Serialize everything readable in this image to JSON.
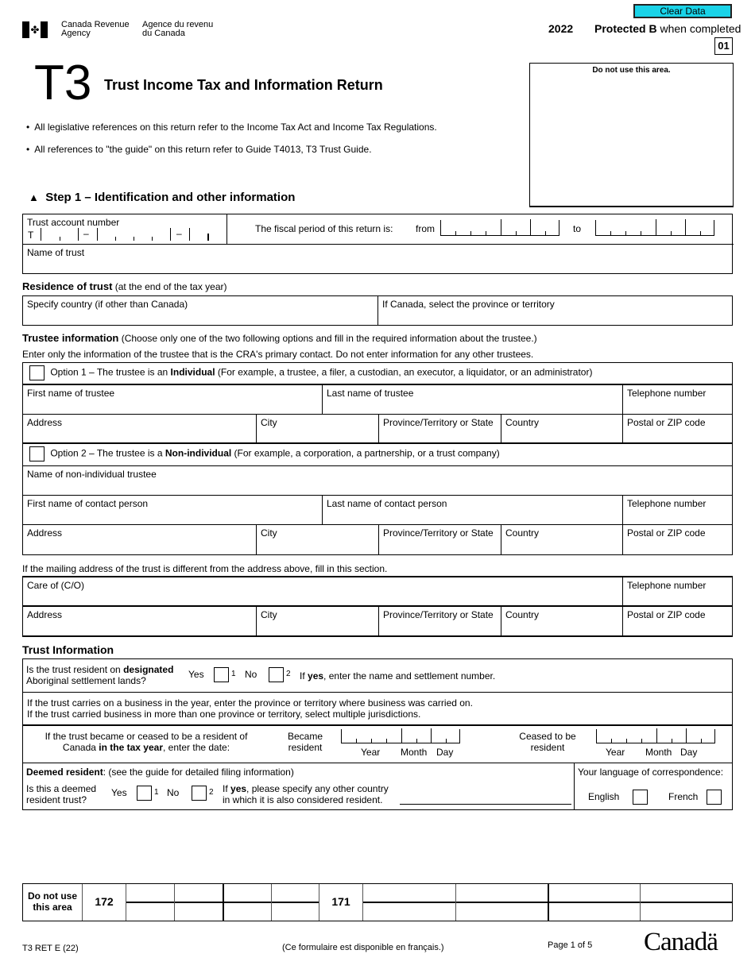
{
  "header": {
    "agency_en": [
      "Canada Revenue",
      "Agency"
    ],
    "agency_fr": [
      "Agence du revenu",
      "du Canada"
    ],
    "clear_button": "Clear Data",
    "year": "2022",
    "protected": "Protected B",
    "protected_suffix": " when completed",
    "page_code": "01",
    "do_not_use": "Do not use this area.",
    "form_code": "T3",
    "title": "Trust Income Tax and Information Return",
    "bullets": [
      "All legislative references on this return refer to the Income Tax Act and Income Tax Regulations.",
      "All references to \"the guide\" on this return refer to Guide T4013, T3 Trust Guide."
    ]
  },
  "step1": {
    "heading": "Step 1 – Identification and other information",
    "account_label": "Trust account number",
    "account_prefix": "T",
    "dash": "–",
    "fiscal_label": "The fiscal period of this return is:",
    "from": "from",
    "to": "to",
    "name_label": "Name of trust"
  },
  "residence": {
    "heading": "Residence of trust",
    "sub": " (at the end of the tax year)",
    "country_label": "Specify country (if other than Canada)",
    "province_label": "If Canada, select the province or territory"
  },
  "trustee": {
    "heading": "Trustee information",
    "sub": " (Choose only one of the two following options and fill in the required information about the trustee.)",
    "note": "Enter only the information of the trustee that is the CRA's primary contact. Do not enter information for any other trustees.",
    "option1_pre": "Option 1 – The trustee is an ",
    "option1_bold": "Individual",
    "option1_post": " (For example, a trustee, a filer, a custodian, an executor, a liquidator, or an administrator)",
    "first_name": "First name of trustee",
    "last_name": "Last name of trustee",
    "telephone": "Telephone number",
    "address": "Address",
    "city": "City",
    "province": "Province/Territory or State",
    "country": "Country",
    "postal": "Postal or ZIP code",
    "option2_pre": "Option 2 – The trustee is a ",
    "option2_bold": "Non-individual",
    "option2_post": " (For example, a corporation, a partnership, or a trust company)",
    "non_ind_name": "Name of non-individual trustee",
    "contact_first": "First name of contact person",
    "contact_last": "Last name of contact person"
  },
  "mailing": {
    "note": "If the mailing address of the trust is different from the address above, fill in this section.",
    "care_of": "Care of (C/O)"
  },
  "trust_info": {
    "heading": "Trust Information",
    "aboriginal_pre": "Is the trust resident on ",
    "aboriginal_bold": "designated",
    "aboriginal_line2": "Aboriginal settlement lands?",
    "yes": "Yes",
    "no": "No",
    "code1": "1",
    "code2": "2",
    "if_yes_pre": "If ",
    "if_yes_bold": "yes",
    "if_yes_post": ", enter the name and settlement number.",
    "business_line1": "If the trust carries on a business in the year, enter the province or territory where business was carried on.",
    "business_line2": "If the trust carried business in more than one province or territory, select multiple jurisdictions.",
    "became_line1": "If the trust became or ceased to be a resident of",
    "became_line2_pre": "Canada ",
    "became_line2_bold": "in the tax year",
    "became_line2_post": ", enter the date:",
    "became_label": [
      "Became",
      "resident"
    ],
    "ceased_label": [
      "Ceased to be",
      "resident"
    ],
    "year": "Year",
    "month": "Month",
    "day": "Day",
    "deemed_bold": "Deemed resident",
    "deemed_post": ": (see the guide for detailed filing information)",
    "deemed_q": [
      "Is this a deemed",
      "resident trust?"
    ],
    "deemed_specify_pre": "If ",
    "deemed_specify_bold": "yes",
    "deemed_specify_post": ", please specify any other country",
    "deemed_specify_line2": "in which it is also considered resident.",
    "language_label": "Your language of correspondence:",
    "english": "English",
    "french": "French"
  },
  "bottom_table": {
    "do_not_use": [
      "Do not use",
      "this area"
    ],
    "code_172": "172",
    "code_171": "171"
  },
  "footer": {
    "form_id": "T3 RET E (22)",
    "french_note": "(Ce formulaire est disponible en français.)",
    "page": "Page 1 of 5",
    "wordmark": "Canadä"
  }
}
